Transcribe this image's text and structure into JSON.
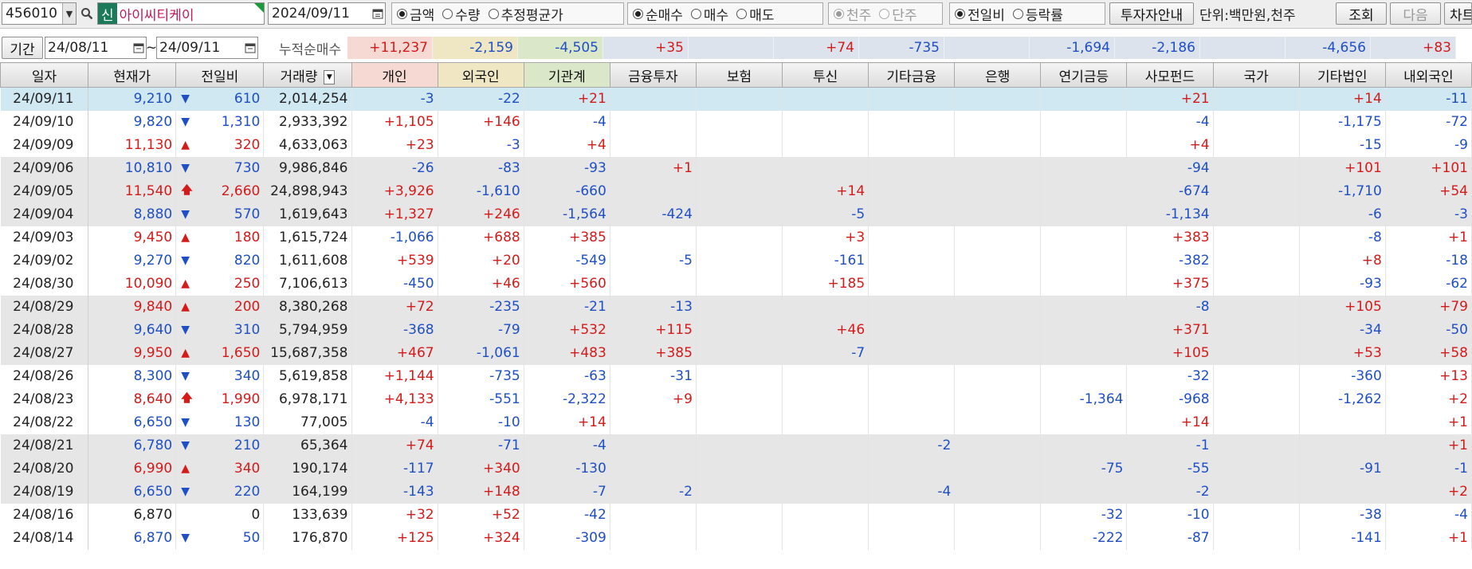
{
  "toolbar": {
    "code": "456010",
    "badge": "신",
    "stock_name": "아이씨티케이",
    "date": "2024/09/11",
    "radio_group1": [
      {
        "label": "금액",
        "checked": true
      },
      {
        "label": "수량",
        "checked": false
      },
      {
        "label": "추정평균가",
        "checked": false
      }
    ],
    "radio_group2": [
      {
        "label": "순매수",
        "checked": true
      },
      {
        "label": "매수",
        "checked": false
      },
      {
        "label": "매도",
        "checked": false
      }
    ],
    "radio_group3": [
      {
        "label": "천주",
        "checked": true
      },
      {
        "label": "단주",
        "checked": false
      }
    ],
    "radio_group4": [
      {
        "label": "전일비",
        "checked": true
      },
      {
        "label": "등락률",
        "checked": false
      }
    ],
    "investor_guide": "투자자안내",
    "unit": "단위:백만원,천주",
    "query": "조회",
    "next": "다음",
    "chart": "차트"
  },
  "period": {
    "label": "기간",
    "from": "24/08/11",
    "tilde": "~",
    "to": "24/09/11",
    "cumulative_label": "누적순매수"
  },
  "summary": [
    "+11,237",
    "-2,159",
    "-4,505",
    "+35",
    "",
    "+74",
    "-735",
    "",
    "-1,694",
    "-2,186",
    "",
    "-4,656",
    "+83"
  ],
  "columns": [
    "일자",
    "현재가",
    "전일비",
    "거래량",
    "개인",
    "외국인",
    "기관계",
    "금융투자",
    "보험",
    "투신",
    "기타금융",
    "은행",
    "연기금등",
    "사모펀드",
    "국가",
    "기타법인",
    "내외국인"
  ],
  "colors": {
    "up": "#d51a1a",
    "down": "#1f4fc5",
    "selected": "#cfe8f2",
    "gray_row": "#e6e6e6"
  },
  "rows": [
    {
      "date": "24/09/11",
      "price": "9,210",
      "dir": "down",
      "chg": "610",
      "vol": "2,014,254",
      "v": [
        "-3",
        "-22",
        "+21",
        "",
        "",
        "",
        "",
        "",
        "",
        "+21",
        "",
        "+14",
        "-11"
      ]
    },
    {
      "date": "24/09/10",
      "price": "9,820",
      "dir": "down",
      "chg": "1,310",
      "vol": "2,933,392",
      "v": [
        "+1,105",
        "+146",
        "-4",
        "",
        "",
        "",
        "",
        "",
        "",
        "-4",
        "",
        "-1,175",
        "-72"
      ]
    },
    {
      "date": "24/09/09",
      "price": "11,130",
      "dir": "up",
      "chg": "320",
      "vol": "4,633,063",
      "v": [
        "+23",
        "-3",
        "+4",
        "",
        "",
        "",
        "",
        "",
        "",
        "+4",
        "",
        "-15",
        "-9"
      ]
    },
    {
      "date": "24/09/06",
      "price": "10,810",
      "dir": "down",
      "chg": "730",
      "vol": "9,986,846",
      "v": [
        "-26",
        "-83",
        "-93",
        "+1",
        "",
        "",
        "",
        "",
        "",
        "-94",
        "",
        "+101",
        "+101"
      ]
    },
    {
      "date": "24/09/05",
      "price": "11,540",
      "dir": "limit",
      "chg": "2,660",
      "vol": "24,898,943",
      "v": [
        "+3,926",
        "-1,610",
        "-660",
        "",
        "",
        "+14",
        "",
        "",
        "",
        "-674",
        "",
        "-1,710",
        "+54"
      ]
    },
    {
      "date": "24/09/04",
      "price": "8,880",
      "dir": "down",
      "chg": "570",
      "vol": "1,619,643",
      "v": [
        "+1,327",
        "+246",
        "-1,564",
        "-424",
        "",
        "-5",
        "",
        "",
        "",
        "-1,134",
        "",
        "-6",
        "-3"
      ]
    },
    {
      "date": "24/09/03",
      "price": "9,450",
      "dir": "up",
      "chg": "180",
      "vol": "1,615,724",
      "v": [
        "-1,066",
        "+688",
        "+385",
        "",
        "",
        "+3",
        "",
        "",
        "",
        "+383",
        "",
        "-8",
        "+1"
      ]
    },
    {
      "date": "24/09/02",
      "price": "9,270",
      "dir": "down",
      "chg": "820",
      "vol": "1,611,608",
      "v": [
        "+539",
        "+20",
        "-549",
        "-5",
        "",
        "-161",
        "",
        "",
        "",
        "-382",
        "",
        "+8",
        "-18"
      ]
    },
    {
      "date": "24/08/30",
      "price": "10,090",
      "dir": "up",
      "chg": "250",
      "vol": "7,106,613",
      "v": [
        "-450",
        "+46",
        "+560",
        "",
        "",
        "+185",
        "",
        "",
        "",
        "+375",
        "",
        "-93",
        "-62"
      ]
    },
    {
      "date": "24/08/29",
      "price": "9,840",
      "dir": "up",
      "chg": "200",
      "vol": "8,380,268",
      "v": [
        "+72",
        "-235",
        "-21",
        "-13",
        "",
        "",
        "",
        "",
        "",
        "-8",
        "",
        "+105",
        "+79"
      ]
    },
    {
      "date": "24/08/28",
      "price": "9,640",
      "dir": "down",
      "chg": "310",
      "vol": "5,794,959",
      "v": [
        "-368",
        "-79",
        "+532",
        "+115",
        "",
        "+46",
        "",
        "",
        "",
        "+371",
        "",
        "-34",
        "-50"
      ]
    },
    {
      "date": "24/08/27",
      "price": "9,950",
      "dir": "up",
      "chg": "1,650",
      "vol": "15,687,358",
      "v": [
        "+467",
        "-1,061",
        "+483",
        "+385",
        "",
        "-7",
        "",
        "",
        "",
        "+105",
        "",
        "+53",
        "+58"
      ]
    },
    {
      "date": "24/08/26",
      "price": "8,300",
      "dir": "down",
      "chg": "340",
      "vol": "5,619,858",
      "v": [
        "+1,144",
        "-735",
        "-63",
        "-31",
        "",
        "",
        "",
        "",
        "",
        "-32",
        "",
        "-360",
        "+13"
      ]
    },
    {
      "date": "24/08/23",
      "price": "8,640",
      "dir": "limit",
      "chg": "1,990",
      "vol": "6,978,171",
      "v": [
        "+4,133",
        "-551",
        "-2,322",
        "+9",
        "",
        "",
        "",
        "",
        "-1,364",
        "-968",
        "",
        "-1,262",
        "+2"
      ]
    },
    {
      "date": "24/08/22",
      "price": "6,650",
      "dir": "down",
      "chg": "130",
      "vol": "77,005",
      "v": [
        "-4",
        "-10",
        "+14",
        "",
        "",
        "",
        "",
        "",
        "",
        "+14",
        "",
        "",
        "+1"
      ]
    },
    {
      "date": "24/08/21",
      "price": "6,780",
      "dir": "down",
      "chg": "210",
      "vol": "65,364",
      "v": [
        "+74",
        "-71",
        "-4",
        "",
        "",
        "",
        "-2",
        "",
        "",
        "-1",
        "",
        "",
        "+1"
      ]
    },
    {
      "date": "24/08/20",
      "price": "6,990",
      "dir": "up",
      "chg": "340",
      "vol": "190,174",
      "v": [
        "-117",
        "+340",
        "-130",
        "",
        "",
        "",
        "",
        "",
        "-75",
        "-55",
        "",
        "-91",
        "-1"
      ]
    },
    {
      "date": "24/08/19",
      "price": "6,650",
      "dir": "down",
      "chg": "220",
      "vol": "164,199",
      "v": [
        "-143",
        "+148",
        "-7",
        "-2",
        "",
        "",
        "-4",
        "",
        "",
        "-2",
        "",
        "",
        "+2"
      ]
    },
    {
      "date": "24/08/16",
      "price": "6,870",
      "dir": "none",
      "chg": "0",
      "vol": "133,639",
      "v": [
        "+32",
        "+52",
        "-42",
        "",
        "",
        "",
        "",
        "",
        "-32",
        "-10",
        "",
        "-38",
        "-4"
      ]
    },
    {
      "date": "24/08/14",
      "price": "6,870",
      "dir": "down",
      "chg": "50",
      "vol": "176,870",
      "v": [
        "+125",
        "+324",
        "-309",
        "",
        "",
        "",
        "",
        "",
        "-222",
        "-87",
        "",
        "-141",
        "+1"
      ]
    }
  ]
}
